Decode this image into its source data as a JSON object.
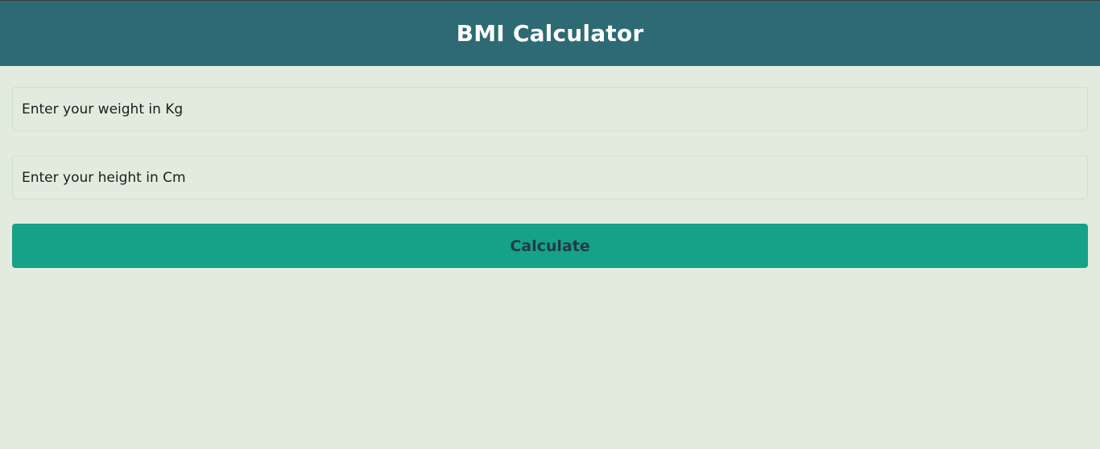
{
  "colors": {
    "header_bg": "#2d6a74",
    "page_bg": "#e1ecdf",
    "button_bg": "#16a287",
    "button_text": "#1f3b4a"
  },
  "header": {
    "title": "BMI Calculator"
  },
  "form": {
    "weight": {
      "placeholder": "Enter your weight in Kg",
      "value": ""
    },
    "height": {
      "placeholder": "Enter your height in Cm",
      "value": ""
    },
    "calculate_label": "Calculate"
  }
}
